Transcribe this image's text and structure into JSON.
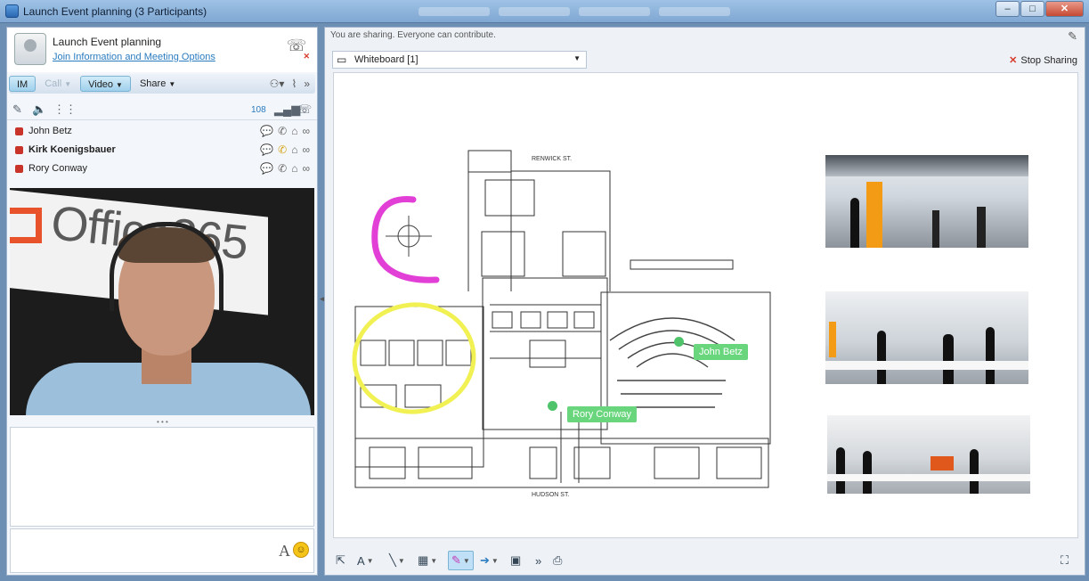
{
  "window": {
    "title": "Launch Event planning (3 Participants)",
    "minimize": "–",
    "maximize": "□",
    "close": "✕"
  },
  "conversation": {
    "title": "Launch Event planning",
    "join_link": "Join Information and Meeting Options"
  },
  "modalities": {
    "im": "IM",
    "call": "Call",
    "video": "Video",
    "share": "Share"
  },
  "tools": {
    "volume_level": "108"
  },
  "participants": [
    {
      "name": "John Betz",
      "bold": false
    },
    {
      "name": "Kirk Koenigsbauer",
      "bold": true
    },
    {
      "name": "Rory Conway",
      "bold": false
    }
  ],
  "video": {
    "banner_text": "Office365"
  },
  "compose": {
    "font_button": "A",
    "emoticon": "☺"
  },
  "stage": {
    "sharing_note": "You are sharing. Everyone can contribute.",
    "content_selector": "Whiteboard [1]",
    "stop_sharing": "Stop Sharing"
  },
  "whiteboard": {
    "street_top": "RENWICK ST.",
    "street_bottom": "HUDSON ST.",
    "pointer_labels": [
      "John Betz",
      "Rory Conway"
    ]
  },
  "colors": {
    "annotation_pink": "#e23fd6",
    "annotation_yellow": "#f1f153",
    "pointer_green": "#69d67e",
    "status_red": "#c8342a",
    "link_blue": "#2a7bbf"
  }
}
